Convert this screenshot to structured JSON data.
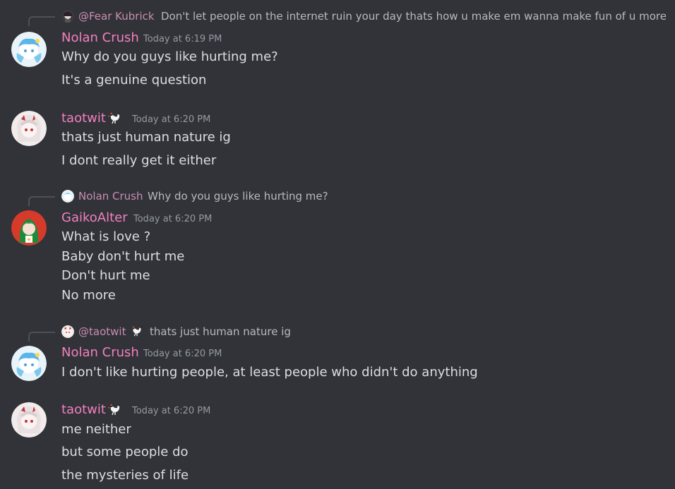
{
  "messages": [
    {
      "reply": {
        "name": "@Fear Kubrick",
        "text": "Don't let people on the internet ruin your day thats how u make em wanna make fun of u more"
      },
      "author": "Nolan Crush",
      "timestamp": "Today at 6:19 PM",
      "lines": [
        "Why do you guys like hurting me?",
        "It's a genuine question"
      ]
    },
    {
      "author": "taotwit",
      "timestamp": "Today at 6:20 PM",
      "lines": [
        "thats just human nature ig",
        "I dont really get it either"
      ]
    },
    {
      "reply": {
        "name": "Nolan Crush",
        "text": "Why do you guys like hurting me?"
      },
      "author": "GaikoAlter",
      "timestamp": "Today at 6:20 PM",
      "lines": [
        "What is love ?",
        "Baby don't hurt me",
        "Don't hurt me",
        "No more"
      ]
    },
    {
      "reply": {
        "name": "@taotwit",
        "text": "thats just human nature ig"
      },
      "author": "Nolan Crush",
      "timestamp": "Today at 6:20 PM",
      "lines": [
        "I don't like hurting people, at least people who didn't do anything"
      ]
    },
    {
      "author": "taotwit",
      "timestamp": "Today at 6:20 PM",
      "lines": [
        "me neither",
        "but some people do",
        "the mysteries of life"
      ]
    }
  ],
  "colors": {
    "background": "#313338",
    "username": "#f47fbf",
    "reply_name": "#c98db1",
    "message_text": "#dbdee1",
    "timestamp": "#949ba4"
  },
  "icons": {
    "author_badge": "rooster-icon"
  }
}
